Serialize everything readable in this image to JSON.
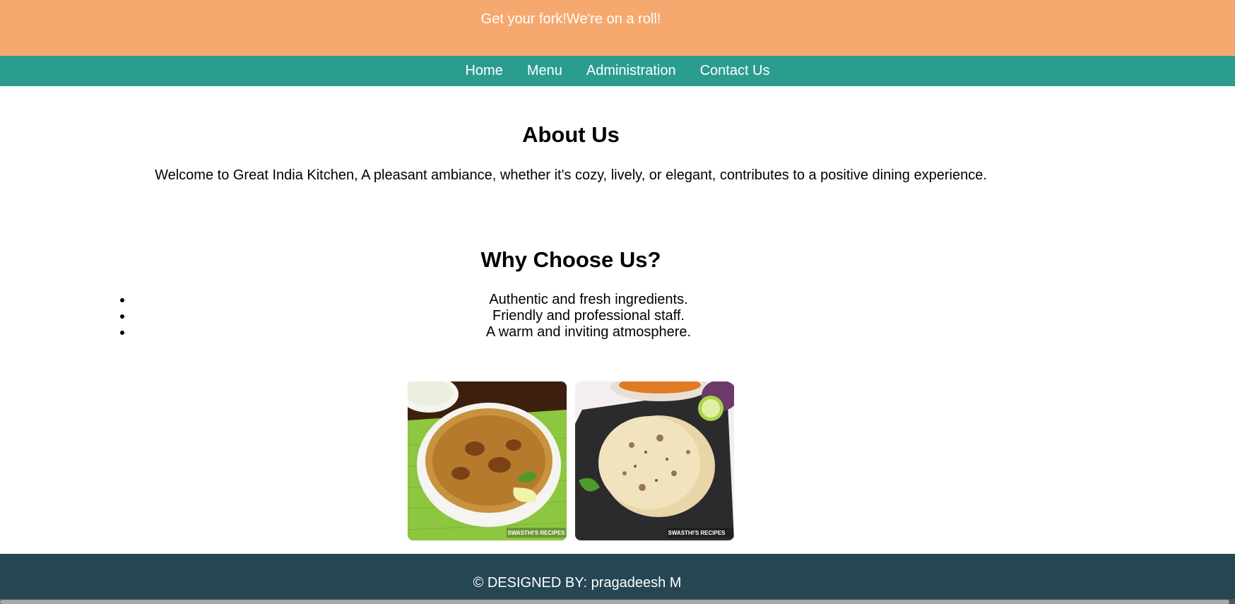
{
  "banner": {
    "text": "Get your fork!We're on a roll!",
    "color": "#f6a96f"
  },
  "nav": {
    "color": "#2a9d8f",
    "items": [
      {
        "label": "Home"
      },
      {
        "label": "Menu"
      },
      {
        "label": "Administration"
      },
      {
        "label": "Contact Us"
      }
    ]
  },
  "about": {
    "title": "About Us",
    "text": "Welcome to Great India Kitchen, A pleasant ambiance, whether it's cozy, lively, or elegant, contributes to a positive dining experience."
  },
  "why": {
    "title": "Why Choose Us?",
    "items": [
      "Authentic and fresh ingredients.",
      "Friendly and professional staff.",
      "A warm and inviting atmosphere."
    ]
  },
  "gallery": {
    "images": [
      {
        "icon": "biryani-image",
        "watermark": "SWASTHI'S RECIPES"
      },
      {
        "icon": "naan-image",
        "watermark": "SWASTHI'S RECIPES"
      }
    ]
  },
  "footer": {
    "text": "© DESIGNED BY: pragadeesh M",
    "color": "#264653"
  }
}
